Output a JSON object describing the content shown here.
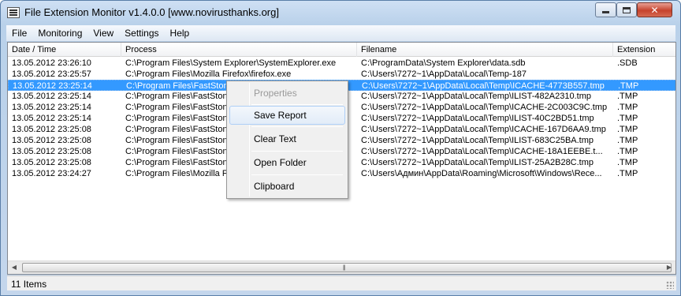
{
  "window": {
    "title": "File Extension Monitor v1.4.0.0 [www.novirusthanks.org]",
    "close_glyph": "✕"
  },
  "menu": [
    "File",
    "Monitoring",
    "View",
    "Settings",
    "Help"
  ],
  "columns": [
    "Date / Time",
    "Process",
    "Filename",
    "Extension"
  ],
  "rows": [
    {
      "date": "13.05.2012 23:26:10",
      "process": "C:\\Program Files\\System Explorer\\SystemExplorer.exe",
      "filename": "C:\\ProgramData\\System Explorer\\data.sdb",
      "ext": ".SDB"
    },
    {
      "date": "13.05.2012 23:25:57",
      "process": "C:\\Program Files\\Mozilla Firefox\\firefox.exe",
      "filename": "C:\\Users\\7272~1\\AppData\\Local\\Temp-187",
      "ext": ""
    },
    {
      "date": "13.05.2012 23:25:14",
      "process": "C:\\Program Files\\FastStone",
      "filename": "C:\\Users\\7272~1\\AppData\\Local\\Temp\\ICACHE-4773B557.tmp",
      "ext": ".TMP"
    },
    {
      "date": "13.05.2012 23:25:14",
      "process": "C:\\Program Files\\FastStone",
      "filename": "C:\\Users\\7272~1\\AppData\\Local\\Temp\\ILIST-482A2310.tmp",
      "ext": ".TMP"
    },
    {
      "date": "13.05.2012 23:25:14",
      "process": "C:\\Program Files\\FastStone",
      "filename": "C:\\Users\\7272~1\\AppData\\Local\\Temp\\ICACHE-2C003C9C.tmp",
      "ext": ".TMP"
    },
    {
      "date": "13.05.2012 23:25:14",
      "process": "C:\\Program Files\\FastStone",
      "filename": "C:\\Users\\7272~1\\AppData\\Local\\Temp\\ILIST-40C2BD51.tmp",
      "ext": ".TMP"
    },
    {
      "date": "13.05.2012 23:25:08",
      "process": "C:\\Program Files\\FastStone",
      "filename": "C:\\Users\\7272~1\\AppData\\Local\\Temp\\ICACHE-167D6AA9.tmp",
      "ext": ".TMP"
    },
    {
      "date": "13.05.2012 23:25:08",
      "process": "C:\\Program Files\\FastStone",
      "filename": "C:\\Users\\7272~1\\AppData\\Local\\Temp\\ILIST-683C25BA.tmp",
      "ext": ".TMP"
    },
    {
      "date": "13.05.2012 23:25:08",
      "process": "C:\\Program Files\\FastStone",
      "filename": "C:\\Users\\7272~1\\AppData\\Local\\Temp\\ICACHE-18A1EEBE.t...",
      "ext": ".TMP"
    },
    {
      "date": "13.05.2012 23:25:08",
      "process": "C:\\Program Files\\FastStone",
      "filename": "C:\\Users\\7272~1\\AppData\\Local\\Temp\\ILIST-25A2B28C.tmp",
      "ext": ".TMP"
    },
    {
      "date": "13.05.2012 23:24:27",
      "process": "C:\\Program Files\\Mozilla Fire",
      "filename": "C:\\Users\\Админ\\AppData\\Roaming\\Microsoft\\Windows\\Rece...",
      "ext": ".TMP"
    }
  ],
  "selected_row": 2,
  "context_menu": {
    "items": [
      {
        "label": "Properties",
        "disabled": true
      },
      {
        "label": "Save Report",
        "hover": true
      },
      {
        "label": "Clear Text"
      },
      {
        "label": "Open Folder"
      },
      {
        "label": "Clipboard"
      }
    ]
  },
  "scrollbar": {
    "left_arrow": "◀",
    "right_arrow": "▶",
    "grip": "|||"
  },
  "status": {
    "text": "11 Items"
  },
  "colors": {
    "selection": "#3399ff",
    "close_button": "#c6422c"
  }
}
